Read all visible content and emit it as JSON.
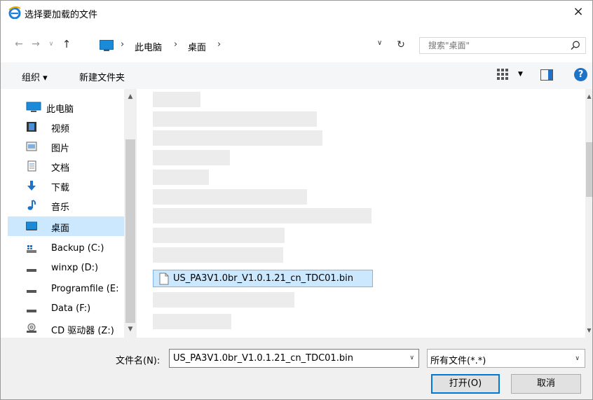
{
  "window": {
    "title": "选择要加载的文件",
    "close_label": "×"
  },
  "address": {
    "segments": [
      "此电脑",
      "桌面"
    ],
    "search_placeholder": "搜索\"桌面\""
  },
  "toolbar": {
    "organize": "组织 ▾",
    "new_folder": "新建文件夹",
    "help": "?"
  },
  "nav": {
    "root": "此电脑",
    "items": [
      {
        "label": "视频",
        "icon": "video-icon"
      },
      {
        "label": "图片",
        "icon": "pictures-icon"
      },
      {
        "label": "文档",
        "icon": "documents-icon"
      },
      {
        "label": "下载",
        "icon": "download-icon"
      },
      {
        "label": "音乐",
        "icon": "music-icon"
      },
      {
        "label": "桌面",
        "icon": "desktop-icon",
        "selected": true
      },
      {
        "label": "Backup (C:)",
        "icon": "system-drive-icon"
      },
      {
        "label": "winxp (D:)",
        "icon": "drive-icon"
      },
      {
        "label": "Programfile (E:",
        "icon": "drive-icon"
      },
      {
        "label": "Data (F:)",
        "icon": "drive-icon"
      },
      {
        "label": "CD 驱动器 (Z:)",
        "icon": "cd-drive-icon"
      }
    ]
  },
  "files": {
    "selected_file": "US_PA3V1.0br_V1.0.1.21_cn_TDC01.bin"
  },
  "bottom": {
    "filename_label": "文件名(N):",
    "filename_value": "US_PA3V1.0br_V1.0.1.21_cn_TDC01.bin",
    "filetype": "所有文件(*.*)",
    "open_label": "打开(O)",
    "cancel_label": "取消"
  },
  "colors": {
    "accent": "#0078d7",
    "selection": "#cce8ff",
    "placeholder": "#ececec"
  }
}
